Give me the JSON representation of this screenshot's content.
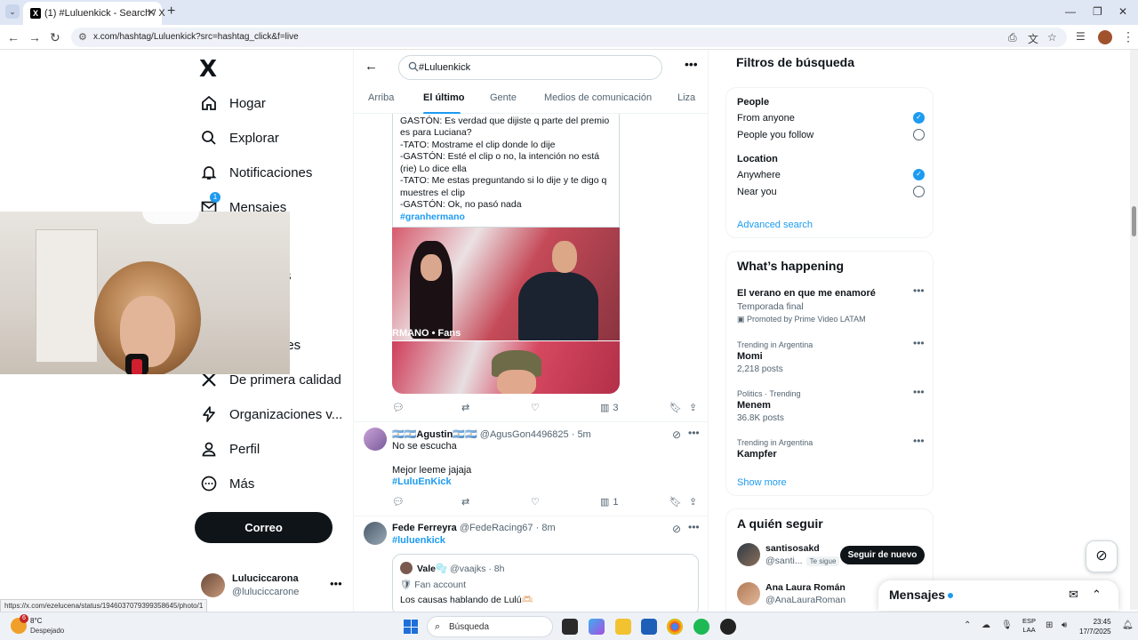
{
  "browser": {
    "tab_title": "(1) #Luluenkick - Search / X",
    "tab_favicon": "X",
    "url": "x.com/hashtag/Luluenkick?src=hashtag_click&f=live",
    "status_url": "https://x.com/ezelucena/status/1946037079399358645/photo/1"
  },
  "sidebar": {
    "logo": "X",
    "items": [
      {
        "label": "Hogar",
        "icon": "home-icon"
      },
      {
        "label": "Explorar",
        "icon": "search-icon"
      },
      {
        "label": "Notificaciones",
        "icon": "bell-icon"
      },
      {
        "label": "Mensajes",
        "icon": "mail-icon",
        "badge": "1"
      },
      {
        "label": "De primera calidad",
        "icon": "x-icon"
      },
      {
        "label": "Organizaciones v...",
        "icon": "lightning-icon"
      },
      {
        "label": "Perfil",
        "icon": "person-icon"
      },
      {
        "label": "Más",
        "icon": "more-circle-icon"
      }
    ],
    "partial_label_1": "s",
    "partial_label_2": "des",
    "post_button": "Correo",
    "account": {
      "name": "Luluciccarona",
      "handle": "@luluciccarone"
    }
  },
  "search": {
    "query": "#Luluenkick",
    "tabs": [
      "Arriba",
      "El último",
      "Gente",
      "Medios de comunicación",
      "Liza"
    ],
    "active_tab": "El último"
  },
  "tweet1": {
    "lines": [
      "GASTÓN: Es verdad que dijiste q parte del premio",
      "es para Luciana?",
      "-TATO: Mostrame el clip donde lo dije",
      "-GASTÓN: Esté el clip o no, la intención no está",
      "(rie) Lo dice ella",
      "-TATO: Me estas preguntando si lo dije y te digo q",
      "muestres el clip",
      "-GASTÓN: Ok, no pasó nada"
    ],
    "hashtag": "#granhermano",
    "media_caption": "RMANO • Fans",
    "views": "3"
  },
  "tweet2": {
    "name": "🇦🇷🇦🇷Agustin🇦🇷🇦🇷",
    "handle": "@AgusGon4496825",
    "time": "· 5m",
    "line1": "No se escucha",
    "line2": "Mejor leeme jajaja",
    "hashtag": "#LuluEnKick",
    "views": "1"
  },
  "tweet3": {
    "name": "Fede Ferreyra",
    "handle": "@FedeRacing67",
    "time": "· 8m",
    "hashtag": "#luluenkick",
    "quote": {
      "name": "Vale🫧",
      "handle": "@vaajks",
      "time": "· 8h",
      "label": "Fan account",
      "text": "Los causas hablando de Lulú🫶🏻"
    }
  },
  "filters": {
    "title": "Filtros de búsqueda",
    "people_head": "People",
    "people_opts": [
      "From anyone",
      "People you follow"
    ],
    "location_head": "Location",
    "location_opts": [
      "Anywhere",
      "Near you"
    ],
    "advanced": "Advanced search"
  },
  "happening": {
    "title": "What’s happening",
    "items": [
      {
        "main": "El verano en que me enamoré",
        "sub": "Temporada final",
        "promo": "Promoted by Prime Video LATAM"
      },
      {
        "small": "Trending in Argentina",
        "main": "Momi",
        "sub": "2,218 posts"
      },
      {
        "small": "Politics · Trending",
        "main": "Menem",
        "sub": "36.8K posts"
      },
      {
        "small": "Trending in Argentina",
        "main": "Kampfer"
      }
    ],
    "show_more": "Show more"
  },
  "who": {
    "title": "A quién seguir",
    "people": [
      {
        "name": "santisosakd",
        "handle": "@santi...",
        "follows_you": "Te sigue",
        "button": "Seguir de nuevo"
      },
      {
        "name": "Ana Laura Román",
        "handle": "@AnaLauraRoman"
      }
    ]
  },
  "dm": {
    "title": "Mensajes"
  },
  "taskbar": {
    "temp": "8°C",
    "weather": "Despejado",
    "weather_badge": "6",
    "search": "Búsqueda",
    "lang1": "ESP",
    "lang2": "LAA",
    "time": "23:45",
    "date": "17/7/2025"
  },
  "colors": {
    "accent": "#1d9bf0",
    "text": "#0f1419",
    "muted": "#536471"
  }
}
